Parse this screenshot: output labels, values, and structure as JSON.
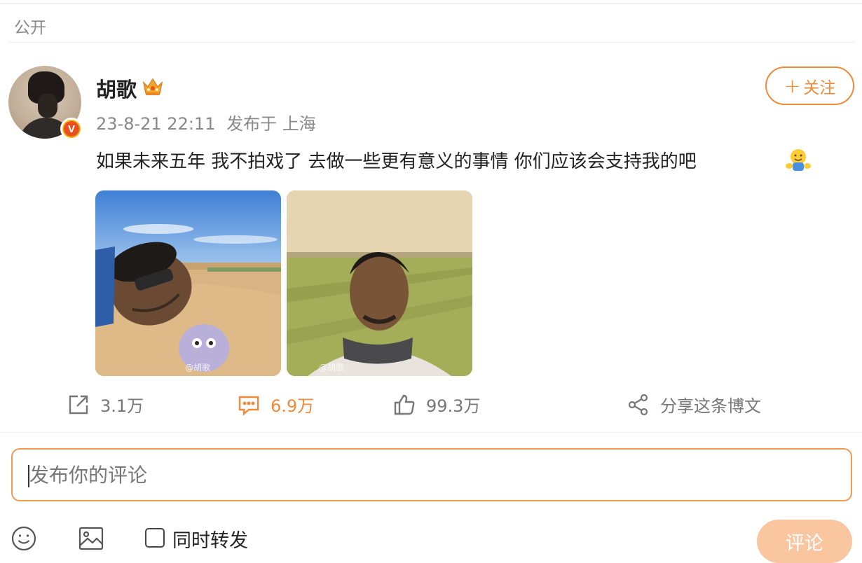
{
  "header": {
    "visibility": "公开"
  },
  "author": {
    "name": "胡歌",
    "verified_badge": "V",
    "time": "23-8-21 22:11",
    "location": "发布于 上海"
  },
  "follow_button": {
    "plus": "+",
    "label": "关注"
  },
  "post": {
    "text": "如果未来五年 我不拍戏了 去做一些更有意义的事情 你们应该会支持我的吧",
    "emoji": "hug-emoji"
  },
  "photos": [
    {
      "watermark": "@胡歌"
    },
    {
      "watermark": "@胡歌"
    }
  ],
  "actions": {
    "repost": "3.1万",
    "comment": "6.9万",
    "like": "99.3万",
    "share": "分享这条博文"
  },
  "comment_box": {
    "placeholder": "发布你的评论",
    "value": ""
  },
  "toolbar": {
    "emoji_icon": "smiley-icon",
    "image_icon": "image-icon",
    "repost_label": "同时转发",
    "repost_checked": false,
    "submit_label": "评论"
  },
  "colors": {
    "accent": "#ee8a3c",
    "submit_disabled": "#f9c6a0",
    "meta": "#888888"
  }
}
